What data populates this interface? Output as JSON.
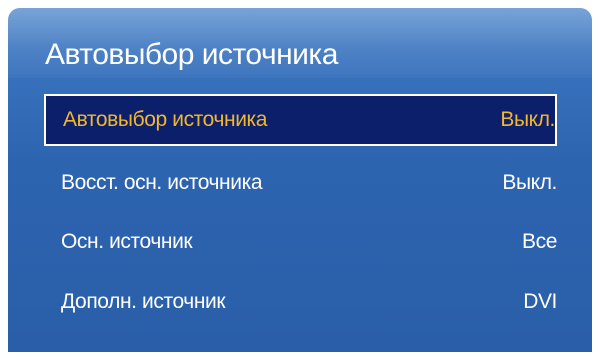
{
  "menu": {
    "title": "Автовыбор источника",
    "items": [
      {
        "label": "Автовыбор источника",
        "value": "Выкл.",
        "selected": true
      },
      {
        "label": "Восст. осн. источника",
        "value": "Выкл.",
        "selected": false
      },
      {
        "label": "Осн. источник",
        "value": "Все",
        "selected": false
      },
      {
        "label": "Дополн. источник",
        "value": "DVI",
        "selected": false
      }
    ]
  },
  "colors": {
    "panel_blue": "#2d64b0",
    "selected_bg": "#0c1f6b",
    "selected_text": "#f2b631",
    "text": "#ffffff"
  }
}
